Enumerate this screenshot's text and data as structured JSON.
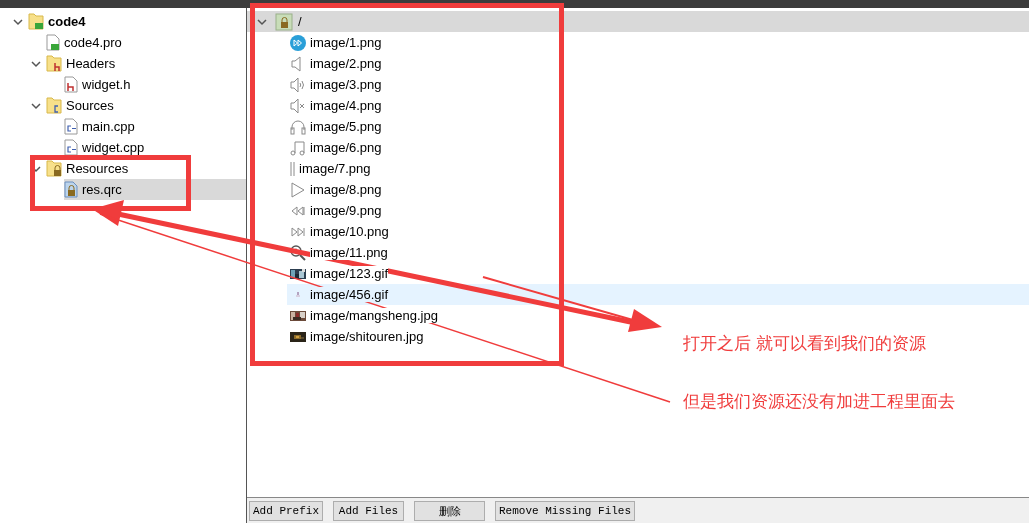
{
  "project_tree": [
    {
      "label": "code4",
      "kind": "project",
      "expanded": true,
      "selected": false,
      "children": [
        {
          "label": "code4.pro",
          "kind": "pro_file",
          "selected": false
        },
        {
          "label": "Headers",
          "kind": "header_folder",
          "expanded": true,
          "selected": false,
          "children": [
            {
              "label": "widget.h",
              "kind": "header",
              "selected": false
            }
          ]
        },
        {
          "label": "Sources",
          "kind": "source_folder",
          "expanded": true,
          "selected": false,
          "children": [
            {
              "label": "main.cpp",
              "kind": "source",
              "selected": false
            },
            {
              "label": "widget.cpp",
              "kind": "source",
              "selected": false
            }
          ]
        },
        {
          "label": "Resources",
          "kind": "resource_folder",
          "expanded": true,
          "selected": false,
          "children": [
            {
              "label": "res.qrc",
              "kind": "resource",
              "selected": true
            }
          ]
        }
      ]
    }
  ],
  "resource_editor": {
    "prefix": {
      "label": "/",
      "expanded": true,
      "selected": true
    },
    "files": [
      {
        "label": "image/1.png",
        "selected": false
      },
      {
        "label": "image/2.png",
        "selected": false
      },
      {
        "label": "image/3.png",
        "selected": false
      },
      {
        "label": "image/4.png",
        "selected": false
      },
      {
        "label": "image/5.png",
        "selected": false
      },
      {
        "label": "image/6.png",
        "selected": false
      },
      {
        "label": "image/7.png",
        "selected": false
      },
      {
        "label": "image/8.png",
        "selected": false
      },
      {
        "label": "image/9.png",
        "selected": false
      },
      {
        "label": "image/10.png",
        "selected": false
      },
      {
        "label": "image/11.png",
        "selected": false
      },
      {
        "label": "image/123.gif",
        "selected": false
      },
      {
        "label": "image/456.gif",
        "selected": true
      },
      {
        "label": "image/mangsheng.jpg",
        "selected": false
      },
      {
        "label": "image/shitouren.jpg",
        "selected": false
      }
    ],
    "buttons": [
      "Add Prefix",
      "Add Files",
      "删除",
      "Remove Missing Files"
    ]
  },
  "annotations": [
    "打开之后 就可以看到我们的资源",
    "但是我们资源还没有加进工程里面去"
  ]
}
